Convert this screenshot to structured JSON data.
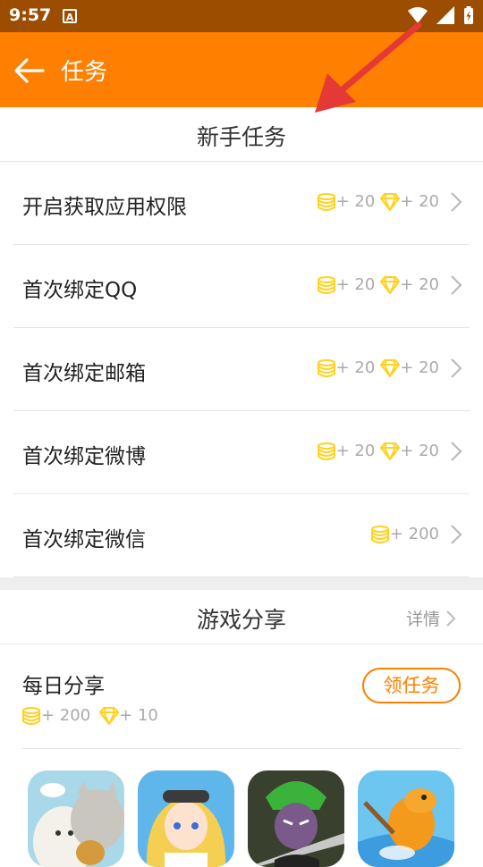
{
  "status": {
    "time": "9:57",
    "notif_glyph": "A"
  },
  "appbar": {
    "title": "任务"
  },
  "newbie": {
    "header": "新手任务",
    "tasks": [
      {
        "name": "开启获取应用权限",
        "coins": "+ 20",
        "gems": "+ 20"
      },
      {
        "name": "首次绑定QQ",
        "coins": "+ 20",
        "gems": "+ 20"
      },
      {
        "name": "首次绑定邮箱",
        "coins": "+ 20",
        "gems": "+ 20"
      },
      {
        "name": "首次绑定微博",
        "coins": "+ 20",
        "gems": "+ 20"
      },
      {
        "name": "首次绑定微信",
        "coins": "+ 200"
      }
    ]
  },
  "share": {
    "header": "游戏分享",
    "more": "详情",
    "daily": {
      "name": "每日分享",
      "coins": "+ 200",
      "gems": "+ 10",
      "button": "领任务"
    }
  },
  "colors": {
    "accent": "#ff7f00",
    "statusbar": "#9c4d00",
    "reward_icon": "#ffd21f",
    "annotation": "#e53935"
  },
  "icons": [
    "back-arrow-icon",
    "coin-stack-icon",
    "diamond-icon",
    "chevron-right-icon",
    "wifi-icon",
    "signal-icon",
    "battery-icon"
  ]
}
